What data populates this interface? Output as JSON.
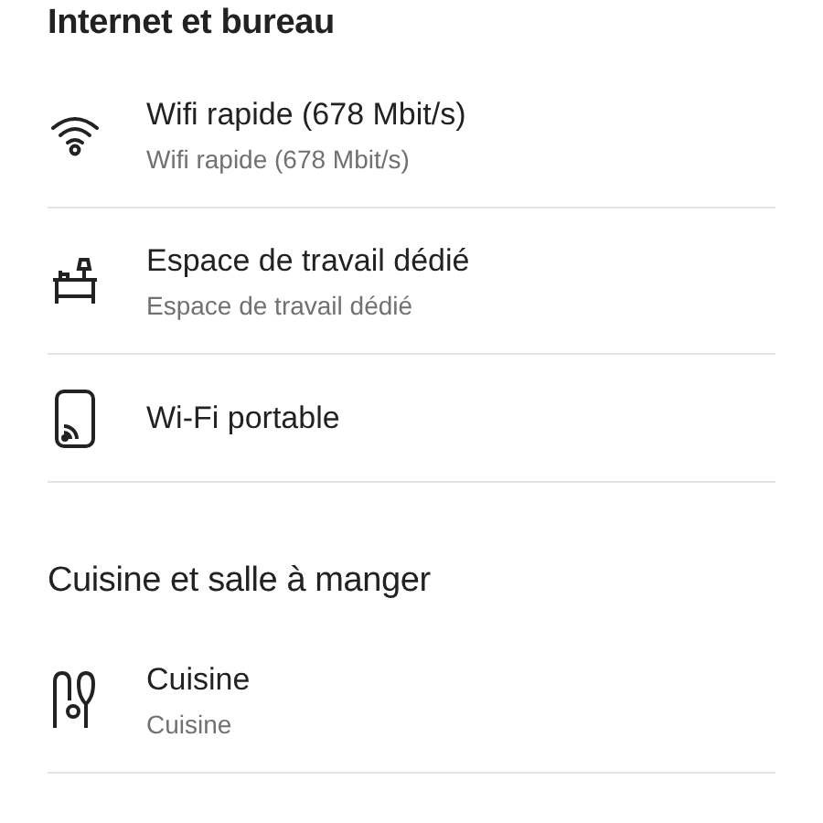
{
  "sections": [
    {
      "title": "Internet et bureau",
      "items": [
        {
          "label": "Wifi rapide (678 Mbit/s)",
          "detail": "Wifi rapide (678 Mbit/s)"
        },
        {
          "label": "Espace de travail dédié",
          "detail": "Espace de travail dédié"
        },
        {
          "label": "Wi-Fi portable"
        }
      ]
    },
    {
      "title": "Cuisine et salle à manger",
      "items": [
        {
          "label": "Cuisine",
          "detail": "Cuisine"
        }
      ]
    }
  ]
}
